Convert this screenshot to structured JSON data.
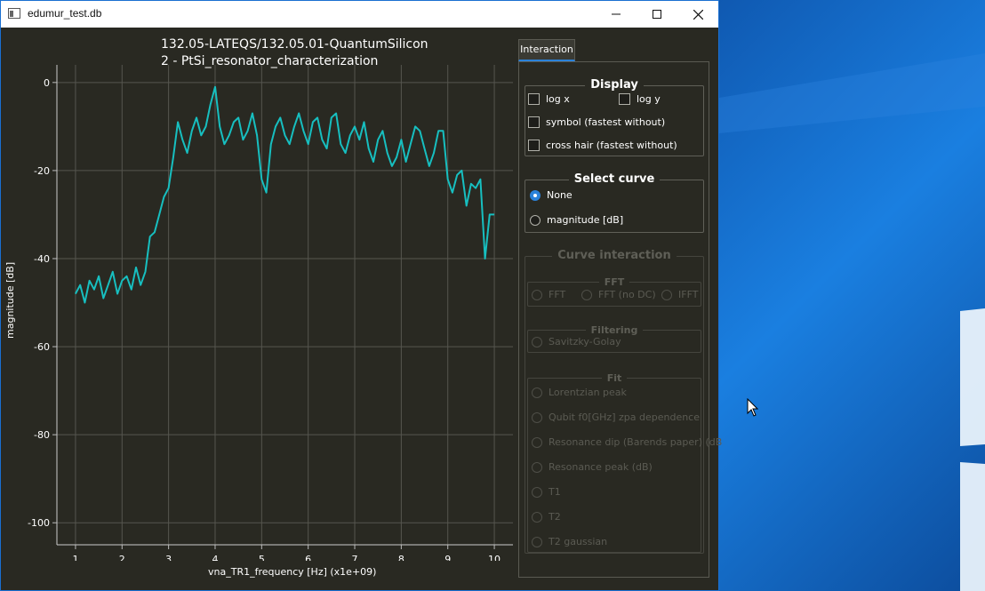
{
  "window": {
    "title": "edumur_test.db",
    "controls": [
      "minimize",
      "maximize",
      "close"
    ]
  },
  "plot": {
    "title_line1": "132.05-LATEQS/132.05.01-QuantumSilicon",
    "title_line2": "2 - PtSi_resonator_characterization",
    "xlabel": "vna_TR1_frequency [Hz] (x1e+09)",
    "ylabel": "magnitude [dB]"
  },
  "chart_data": {
    "type": "line",
    "title": "132.05-LATEQS/132.05.01-QuantumSilicon 2 - PtSi_resonator_characterization",
    "xlabel": "vna_TR1_frequency [Hz] (x1e+09)",
    "ylabel": "magnitude [dB]",
    "xlim": [
      0.6,
      10.4
    ],
    "ylim": [
      -105,
      4
    ],
    "xticks": [
      1,
      2,
      3,
      4,
      5,
      6,
      7,
      8,
      9,
      10
    ],
    "yticks": [
      0,
      -20,
      -40,
      -60,
      -80,
      -100
    ],
    "grid": true,
    "color": "#17bfc0",
    "series": [
      {
        "x": [
          1.0,
          1.1,
          1.2,
          1.3,
          1.4,
          1.5,
          1.6,
          1.7,
          1.8,
          1.9,
          2.0,
          2.1,
          2.2,
          2.3,
          2.4,
          2.5,
          2.6,
          2.7,
          2.8,
          2.9,
          3.0,
          3.1,
          3.2,
          3.3,
          3.4,
          3.5,
          3.6,
          3.7,
          3.8,
          3.9,
          4.0,
          4.1,
          4.2,
          4.3,
          4.4,
          4.5,
          4.6,
          4.7,
          4.8,
          4.9,
          5.0,
          5.1,
          5.2,
          5.3,
          5.4,
          5.5,
          5.6,
          5.7,
          5.8,
          5.9,
          6.0,
          6.1,
          6.2,
          6.3,
          6.4,
          6.5,
          6.6,
          6.7,
          6.8,
          6.9,
          7.0,
          7.1,
          7.2,
          7.3,
          7.4,
          7.5,
          7.6,
          7.7,
          7.8,
          7.9,
          8.0,
          8.1,
          8.2,
          8.3,
          8.4,
          8.5,
          8.6,
          8.7,
          8.8,
          8.9,
          9.0,
          9.1,
          9.2,
          9.3,
          9.4,
          9.5,
          9.6,
          9.7,
          9.8,
          9.9,
          10.0
        ],
        "y": [
          -48,
          -46,
          -50,
          -45,
          -47,
          -44,
          -49,
          -46,
          -43,
          -48,
          -45,
          -44,
          -47,
          -42,
          -46,
          -43,
          -35,
          -34,
          -30,
          -26,
          -24,
          -17,
          -9,
          -13,
          -16,
          -11,
          -8,
          -12,
          -10,
          -5,
          -1,
          -10,
          -14,
          -12,
          -9,
          -8,
          -13,
          -11,
          -7,
          -12,
          -22,
          -25,
          -14,
          -10,
          -8,
          -12,
          -14,
          -10,
          -7,
          -11,
          -14,
          -9,
          -8,
          -13,
          -15,
          -8,
          -7,
          -14,
          -16,
          -12,
          -10,
          -13,
          -9,
          -15,
          -18,
          -13,
          -11,
          -16,
          -19,
          -17,
          -13,
          -18,
          -14,
          -10,
          -11,
          -15,
          -19,
          -16,
          -11,
          -11,
          -22,
          -25,
          -21,
          -20,
          -28,
          -23,
          -24,
          -22,
          -40,
          -30,
          -30
        ]
      }
    ]
  },
  "tab": {
    "label": "Interaction"
  },
  "display": {
    "title": "Display",
    "log_x": "log x",
    "log_y": "log y",
    "symbol": "symbol (fastest without)",
    "cross_hair": "cross hair (fastest without)"
  },
  "select_curve": {
    "title": "Select curve",
    "option_none": "None",
    "option_magnitude": "magnitude [dB]",
    "selected": "None"
  },
  "curve_interaction": {
    "title": "Curve interaction",
    "fft": {
      "title": "FFT",
      "opt1": "FFT",
      "opt2": "FFT (no DC)",
      "opt3": "IFFT"
    },
    "filtering": {
      "title": "Filtering",
      "opt1": "Savitzky-Golay"
    },
    "fit": {
      "title": "Fit",
      "items": [
        "Lorentzian peak",
        "Qubit f0[GHz] zpa dependence",
        "Resonance dip (Barends paper) (dB",
        "Resonance peak (dB)",
        "T1",
        "T2",
        "T2 gaussian"
      ]
    }
  }
}
